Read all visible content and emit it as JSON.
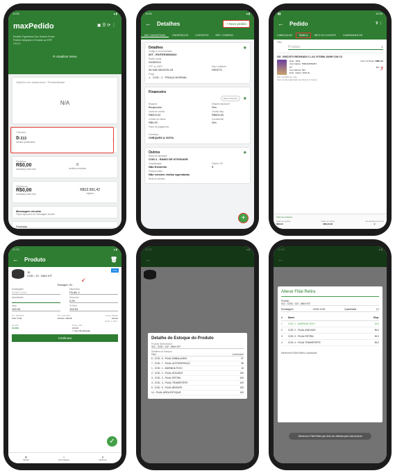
{
  "colors": {
    "primary": "#2e7d32",
    "accent": "#43a047",
    "highlight": "#e53935"
  },
  "s1": {
    "time": "14:51",
    "app": "maxPedido",
    "addr1": "Rodolfo Figueiredo Dos Santos Ferraz",
    "addr2": "Pedido Integrado e Enviado ao ERP",
    "version": "2.8.0.1",
    "update": "Atualizar menu",
    "obj_title": "Objetivo em andamento / Rentabilidade",
    "na": "N/A",
    "clients_title": "Clientes",
    "clients_val": "0",
    "clients_total": "/ 213",
    "clients_sub": "clientes positivados",
    "orders_title": "Pedidos",
    "orders_val": "R$0,00",
    "orders_sub": "vendido(s) este mês",
    "orders_count": "0",
    "orders_count_sub": "pedidos enviados",
    "goals_title": "Objetivos",
    "goals_val": "R$0,00",
    "goals_sub": "vendido(s) este mês",
    "goals_target": "R$13.561,42",
    "goals_target_sub": "objetivo",
    "msg_title": "Mensagem circular",
    "msg_sub": "Toque aqui para ver mensagem circular",
    "products": "Produtos"
  },
  "s2": {
    "time": "14:51",
    "title": "Detalhes",
    "new_order": "Novo pedido",
    "tabs": [
      "INF. CADASTRAIS",
      "ENDEREÇOS",
      "CONTATOS",
      "REF. COMERCI"
    ],
    "details": "Detalhes",
    "l_code": "Código e nome fantasia",
    "code": "207 - EXITESS082022",
    "l_social": "Razão social",
    "social": "24082022",
    "l_cpf": "CPF ou CNPJ",
    "cpf": "06.328.081/0201-81",
    "l_ie": "Inscr. estadual",
    "ie": "ISENTO",
    "l_price": "Praça",
    "price": "1 - COD.: 1 - PRAÇA NORMAL",
    "financial": "Financeiro",
    "fin_btn": "VER POSIÇÃO",
    "l_block": "Bloqueio",
    "block": "Bloqueado",
    "l_nac": "Simples Nacional?",
    "nac": "Sim",
    "l_limit": "Limite de crédito",
    "limit": "R$500,00",
    "l_avail": "Crédito disp.",
    "avail": "R$500,00",
    "l_client": "Crédito do cliente",
    "client": "R$0,00",
    "l_contrib": "Contribuinte",
    "contrib": "Sim",
    "l_plan": "Plano de pagamento",
    "l_charge": "Cobrança",
    "charge": "CHEQUES A VISTA",
    "others": "Outros",
    "l_branch": "Ramo de atividade",
    "branch": "COD.1 - RAMO DE ATIVIDADE",
    "l_class": "Classificação",
    "class": "Não Existente",
    "l_client_vip": "Cliente VIP",
    "vip": "$",
    "l_visit": "Próxima visita",
    "visit": "Não existem visitas agendadas",
    "l_network": "Rede de clientes"
  },
  "s3": {
    "time": "14:54",
    "title": "Pedido",
    "tabs": [
      "CABEÇALHO",
      "TABELA",
      "INFO DO CLIENTE",
      "CAMPANHAS DE"
    ],
    "filter_label": "Filtro",
    "search_ph": "Produto",
    "product": "532 - BISCOITO RECHEADO C LAC VITORIA 100GR C/40 CX",
    "emb_l": "Emb.:",
    "emb": "40X1",
    "cod_l": "Cód. barras:",
    "cod": "7896423953067",
    "st_l": "ST:",
    "pl_l": "Cód. fábrica:",
    "pl": "532",
    "fm_l": "Emb. master:",
    "fm": "40X1(1)",
    "un": "Unit: Un",
    "price_l": "Preço:",
    "price": "R$61,42",
    "est_l": "Est.:",
    "est": "99",
    "note1": "Qtd. vendida por mês",
    "note2": "Sem venda registrada nos últimos 3 meses",
    "footer_total_l": "Total de produtos",
    "f1_l": "Total do pedido",
    "f1": "R$0,00",
    "f2_l": "Saldo c/ Ações",
    "f2": "R$0,00,00",
    "f3_l": "Quantidade de itens",
    "f3": "0"
  },
  "s4": {
    "time": "11:32",
    "title": "Produto",
    "code": "10",
    "name": "COD.: 10 - MAX KIT",
    "tag": "Infos",
    "estoque_label": "Estoque: 91",
    "emb_l": "Embalagem",
    "emb": "CXAS 1X24",
    "filial_l": "Filial retira",
    "filial": "FILIAL 1",
    "qtd_l": "Quantidade",
    "desc_l": "Desconto",
    "desc": "0,00",
    "valor_l": "Valor",
    "valor": "104,94",
    "vtotal_l": "Vl.Total",
    "vtotal": "104,94",
    "ic_l": "CC. Saldo/%:",
    "ic": "0,00 / 0,00",
    "unit_l": "CC. Unit./Tab.:",
    "unit": "104,94 / 209,86",
    "pt_l": "Preço Tabela",
    "pt": "104,94",
    "pl_l": "Preço L. Rev.:",
    "perc_l": "%Lucro:",
    "perc": "21,66%",
    "pu_l": "Preço Unit:",
    "pu": "104,94",
    "bon": "Sem Bonificação",
    "btn": "Continuar",
    "nav": [
      "Tabela",
      "Informações",
      "Histórico"
    ]
  },
  "s5": {
    "time": "11:32",
    "title": "Detalhe do Estoque do Produto",
    "sel_l": "Produto Selecionado:",
    "sel": "112 - COD.: 112 - MAX KIT",
    "det_l": "Detalhes do Estoque",
    "col1": "Filial",
    "col2": "Quantidade",
    "rows": [
      [
        "6 - COD.: 6 - FILIAL EMBALAGEM",
        "97"
      ],
      [
        "7 - COD.: 7 - FILIAL AUTOSSERVIÇO",
        "99"
      ],
      [
        "1 - COD.: 1 - MARINHA TECH",
        "10"
      ],
      [
        "2 - COD.: 2 - FILIAL ATACADO",
        "100"
      ],
      [
        "3 - COD.: 3 - FILIAL RETIRA",
        "100"
      ],
      [
        "4 - COD.: 4 - FILIAL TRANSPORTE",
        "100"
      ],
      [
        "5 - COD.: 5 - FILIAL BROKER",
        "100"
      ],
      [
        "14 - FILIAL AREA ESTOQUE",
        "100"
      ]
    ]
  },
  "s6": {
    "time": "11:32",
    "title": "Alterar Filial Retira",
    "prod_l": "Produto:",
    "prod": "112 - COD.: 112 - MAX KIT",
    "emb_l": "Embalagem",
    "emb": "CXAS 1X24",
    "qtd_l": "Quantidade",
    "qtd": "1,0",
    "col1": "#",
    "col2": "Nome",
    "col3": "Disp.",
    "rows": [
      [
        "1",
        "COD: 1 - MARINHA TECH",
        "10,0"
      ],
      [
        "2",
        "COD: 2 - FILIAL ATACADO",
        "90,0"
      ],
      [
        "3",
        "COD: 3 - FILIAL RETIRA",
        "90,0"
      ],
      [
        "4",
        "COD: 4 - FILIAL TRANSPORTE",
        "90,0"
      ]
    ],
    "nofilial": "Nenhuma Filial Retira Localizada",
    "toast": "Selecione a Filial Retira que deve ser utilizada para esse produto"
  }
}
